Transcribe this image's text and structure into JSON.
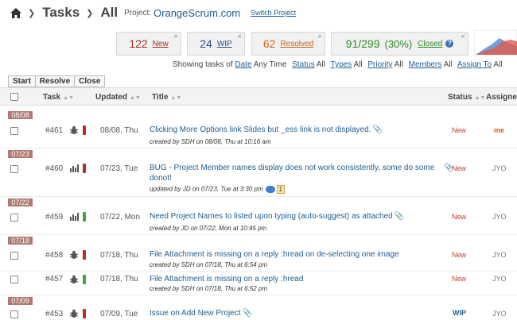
{
  "breadcrumb": {
    "section": "Tasks",
    "filter": "All",
    "project_label": "Project:",
    "project_name": "OrangeScrum.com",
    "switch_label": "Switch Project"
  },
  "stats": {
    "new": {
      "count": "122",
      "label": "New"
    },
    "wip": {
      "count": "24",
      "label": "WIP"
    },
    "resolved": {
      "count": "62",
      "label": "Resolved"
    },
    "closed": {
      "count": "91/299",
      "percent": "(30%)",
      "label": "Closed",
      "help": "?"
    },
    "close_glyph": "×"
  },
  "filters": {
    "prefix": "Showing tasks of",
    "items": [
      {
        "label": "Date",
        "value": "Any Time"
      },
      {
        "label": "Status",
        "value": "All"
      },
      {
        "label": "Types",
        "value": "All"
      },
      {
        "label": "Priority",
        "value": "All"
      },
      {
        "label": "Members",
        "value": "All"
      },
      {
        "label": "Assign To",
        "value": "All"
      }
    ]
  },
  "actions": {
    "start": "Start",
    "resolve": "Resolve",
    "close": "Close"
  },
  "table": {
    "headers": {
      "task": "Task",
      "updated": "Updated",
      "title": "Title",
      "status": "Status",
      "assigned": "Assigned"
    },
    "date_groups": [
      "08/08",
      "07/23",
      "07/22",
      "07/18",
      "07/09"
    ],
    "rows": [
      {
        "num": "#461",
        "type": "bug",
        "priority": "high",
        "updated": "08/08, Thu",
        "title": "Clicking More Options link Slides but _ess link is not displayed.",
        "sub": "created by SDH on 08/08, Thu at 10:16 am",
        "status": "New",
        "assigned": "me"
      },
      {
        "num": "#460",
        "type": "development",
        "priority": "high",
        "updated": "07/23, Tue",
        "title": "BUG - Project Member names display does not work consistently, some do some",
        "title2": "donot!",
        "sub": "updated by JD on 07/23, Tue at 3:30 pm",
        "comments": "1",
        "status": "New",
        "assigned": "JYO"
      },
      {
        "num": "#459",
        "type": "development",
        "priority": "low",
        "updated": "07/22, Mon",
        "title": "Need Project Names to listed upon typing (auto-suggest) as attached",
        "sub": "created by JD on 07/22, Mon at 10:45 pm",
        "status": "New",
        "assigned": "JYO"
      },
      {
        "num": "#458",
        "type": "bug",
        "priority": "high",
        "updated": "07/18, Thu",
        "title": "File Attachment is missing on a reply :hread on de-selecting one image",
        "sub": "created by SDH on 07/18, Thu at 6:54 pm",
        "status": "New",
        "assigned": "JYO"
      },
      {
        "num": "#457",
        "type": "bug",
        "priority": "low",
        "updated": "07/18, Thu",
        "title": "File Attachment is missing on a reply :hread",
        "sub": "created by SDH on 07/18, Thu at 6:52 pm",
        "status": "New",
        "assigned": "JYO"
      },
      {
        "num": "#453",
        "type": "bug",
        "priority": "high",
        "updated": "07/09, Tue",
        "title": "Issue on Add New Project",
        "status": "WIP",
        "assigned": "JYO"
      }
    ]
  },
  "colors": {
    "priority_high": "#b0322a",
    "priority_low": "#3aa83a",
    "date_tag": "#b07a72",
    "link": "#1f5d92"
  }
}
